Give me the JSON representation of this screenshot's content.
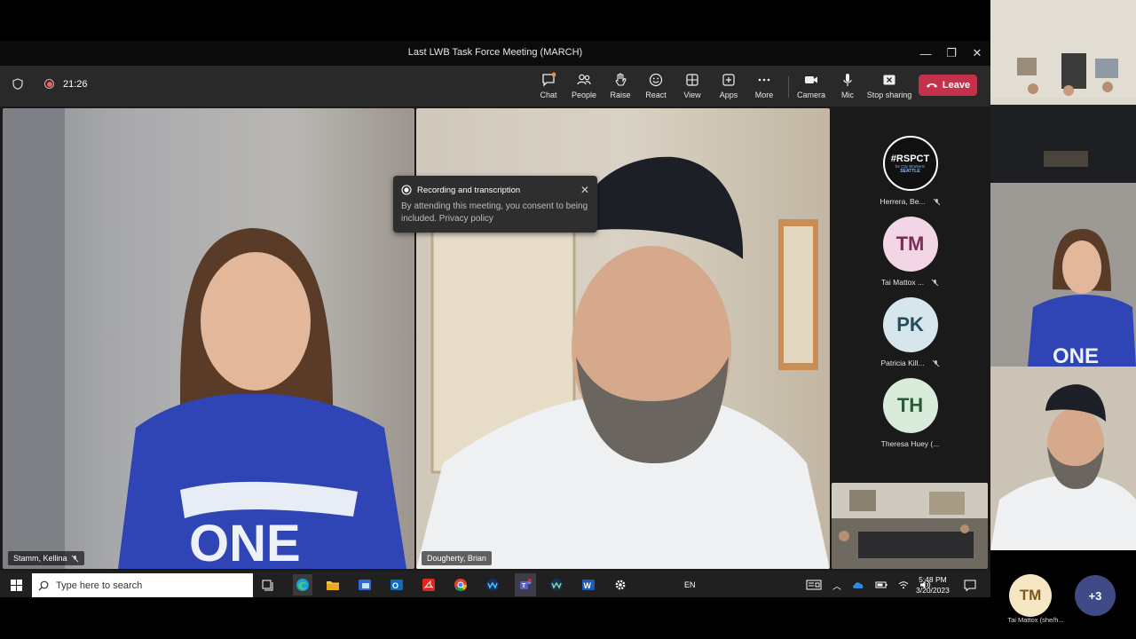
{
  "window": {
    "title": "Last LWB Task Force Meeting (MARCH)",
    "controls": [
      "—",
      "❐",
      "✕"
    ]
  },
  "toolbar": {
    "timer": "21:26",
    "buttons": [
      {
        "id": "chat",
        "label": "Chat"
      },
      {
        "id": "people",
        "label": "People"
      },
      {
        "id": "raise",
        "label": "Raise"
      },
      {
        "id": "react",
        "label": "React"
      },
      {
        "id": "view",
        "label": "View"
      },
      {
        "id": "apps",
        "label": "Apps"
      },
      {
        "id": "more",
        "label": "More"
      },
      {
        "id": "camera",
        "label": "Camera"
      },
      {
        "id": "mic",
        "label": "Mic"
      },
      {
        "id": "stop_sharing",
        "label": "Stop sharing"
      }
    ],
    "leave_label": "Leave",
    "leave_color": "#c4314b"
  },
  "toast": {
    "title": "Recording and transcription",
    "body": "By attending this meeting, you consent to being included. Privacy policy"
  },
  "tiles": {
    "left_name": "Stamm, Kellina",
    "center_name": "Dougherty, Brian"
  },
  "roster": [
    {
      "name": "Herrera, Be...",
      "initials": "#RSPCT",
      "logo_text": "for City Workers!",
      "logo_city": "SEATTLE",
      "muted": true
    },
    {
      "name": "Tai Mattox ...",
      "initials": "TM",
      "color": "#f3d6e6",
      "muted": true
    },
    {
      "name": "Patricia Kill...",
      "initials": "PK",
      "color": "#d7e6ec",
      "muted": true
    },
    {
      "name": "Theresa Huey (...",
      "initials": "TH",
      "color": "#d9ecdc",
      "muted": false
    }
  ],
  "taskbar": {
    "search_placeholder": "Type here to search",
    "language": "EN",
    "time": "5:48 PM",
    "date": "3/20/2023"
  },
  "gallery": {
    "bottom_avatar_initials": "TM",
    "bottom_avatar_name": "Tai Mattox (she/h...",
    "overflow_count": "+3"
  }
}
